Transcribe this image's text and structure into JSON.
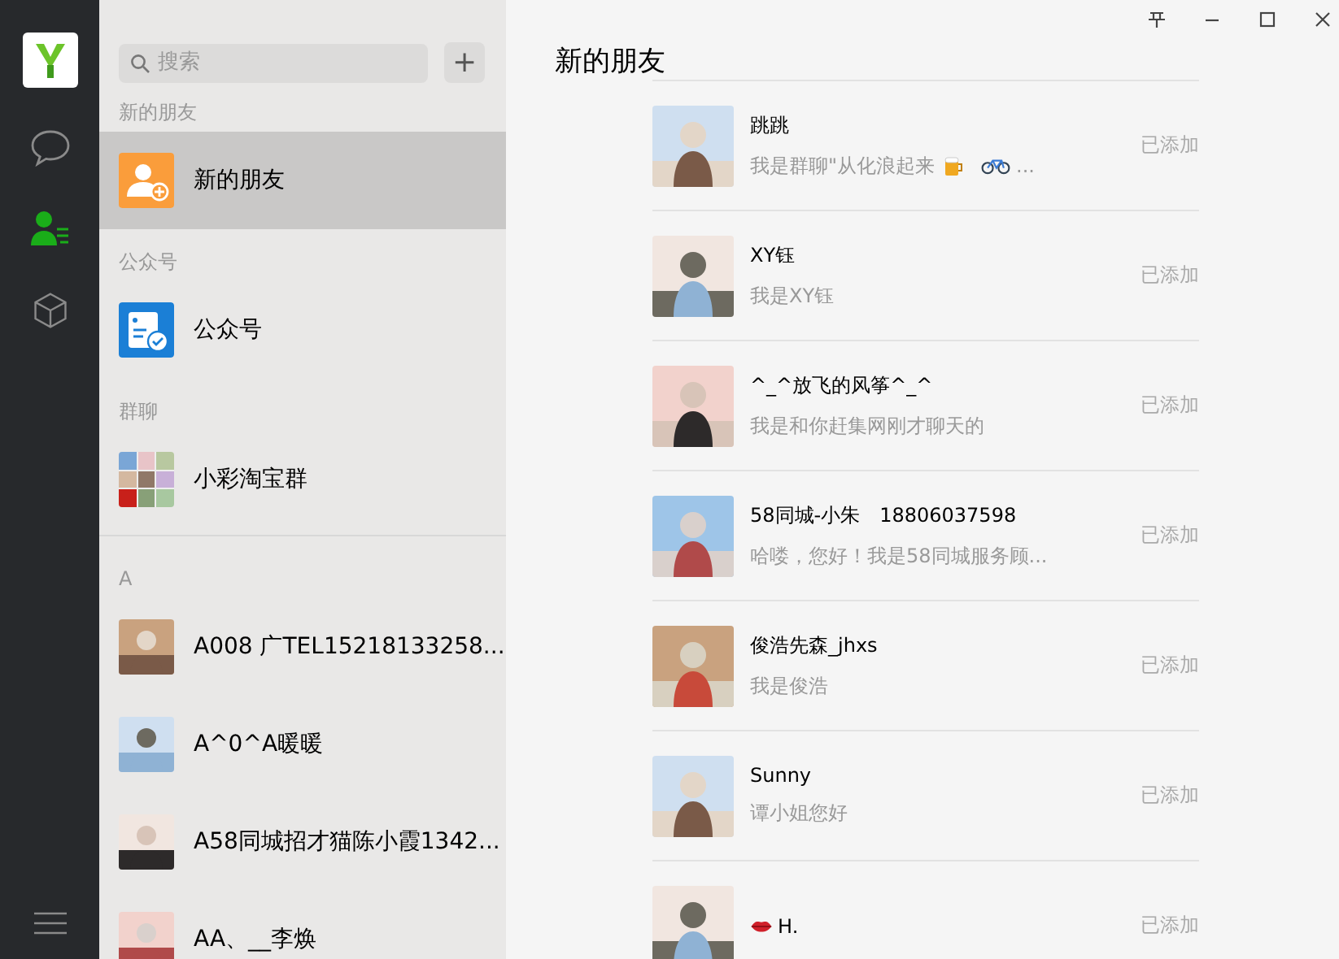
{
  "nav": {
    "items": [
      {
        "kind": "chat",
        "selected": false
      },
      {
        "kind": "contacts",
        "selected": true
      },
      {
        "kind": "box",
        "selected": false
      }
    ]
  },
  "search": {
    "placeholder": "搜索",
    "add_button": "+"
  },
  "contacts": {
    "sections": [
      {
        "header": "新的朋友",
        "items": [
          {
            "name": "新的朋友",
            "kind": "new-friends",
            "selected": true
          }
        ]
      },
      {
        "header": "公众号",
        "items": [
          {
            "name": "公众号",
            "kind": "official",
            "selected": false
          }
        ]
      },
      {
        "header": "群聊",
        "items": [
          {
            "name": "小彩淘宝群",
            "kind": "group",
            "selected": false
          }
        ]
      },
      {
        "header": "A",
        "items": [
          {
            "name": "A008 广TEL15218133258...",
            "selected": false
          },
          {
            "name": "A^0^A暖暖",
            "selected": false
          },
          {
            "name": "A58同城招才猫陈小霞1342...",
            "selected": false
          },
          {
            "name": "AA、__李焕",
            "selected": false
          }
        ]
      }
    ]
  },
  "main": {
    "title": "新的朋友",
    "requests": [
      {
        "name": "跳跳",
        "message": "我是群聊\"从化浪起来",
        "message_icons": [
          {
            "kind": "beer"
          },
          {
            "kind": "bicycle"
          }
        ],
        "message_tail": "...",
        "status": "已添加"
      },
      {
        "name": "XY钰",
        "message": "我是XY钰",
        "status": "已添加"
      },
      {
        "name": "^_^放飞的风筝^_^",
        "message": "我是和你赶集网刚才聊天的",
        "status": "已添加"
      },
      {
        "name": "58同城-小朱　18806037598",
        "message": "哈喽，您好！我是58同城服务顾...",
        "status": "已添加"
      },
      {
        "name": "俊浩先森_jhxs",
        "message": "我是俊浩",
        "status": "已添加"
      },
      {
        "name": "Sunny",
        "message": "谭小姐您好",
        "status": "已添加"
      },
      {
        "name": "H.",
        "name_icon": {
          "kind": "lips"
        },
        "status": "已添加"
      }
    ]
  }
}
